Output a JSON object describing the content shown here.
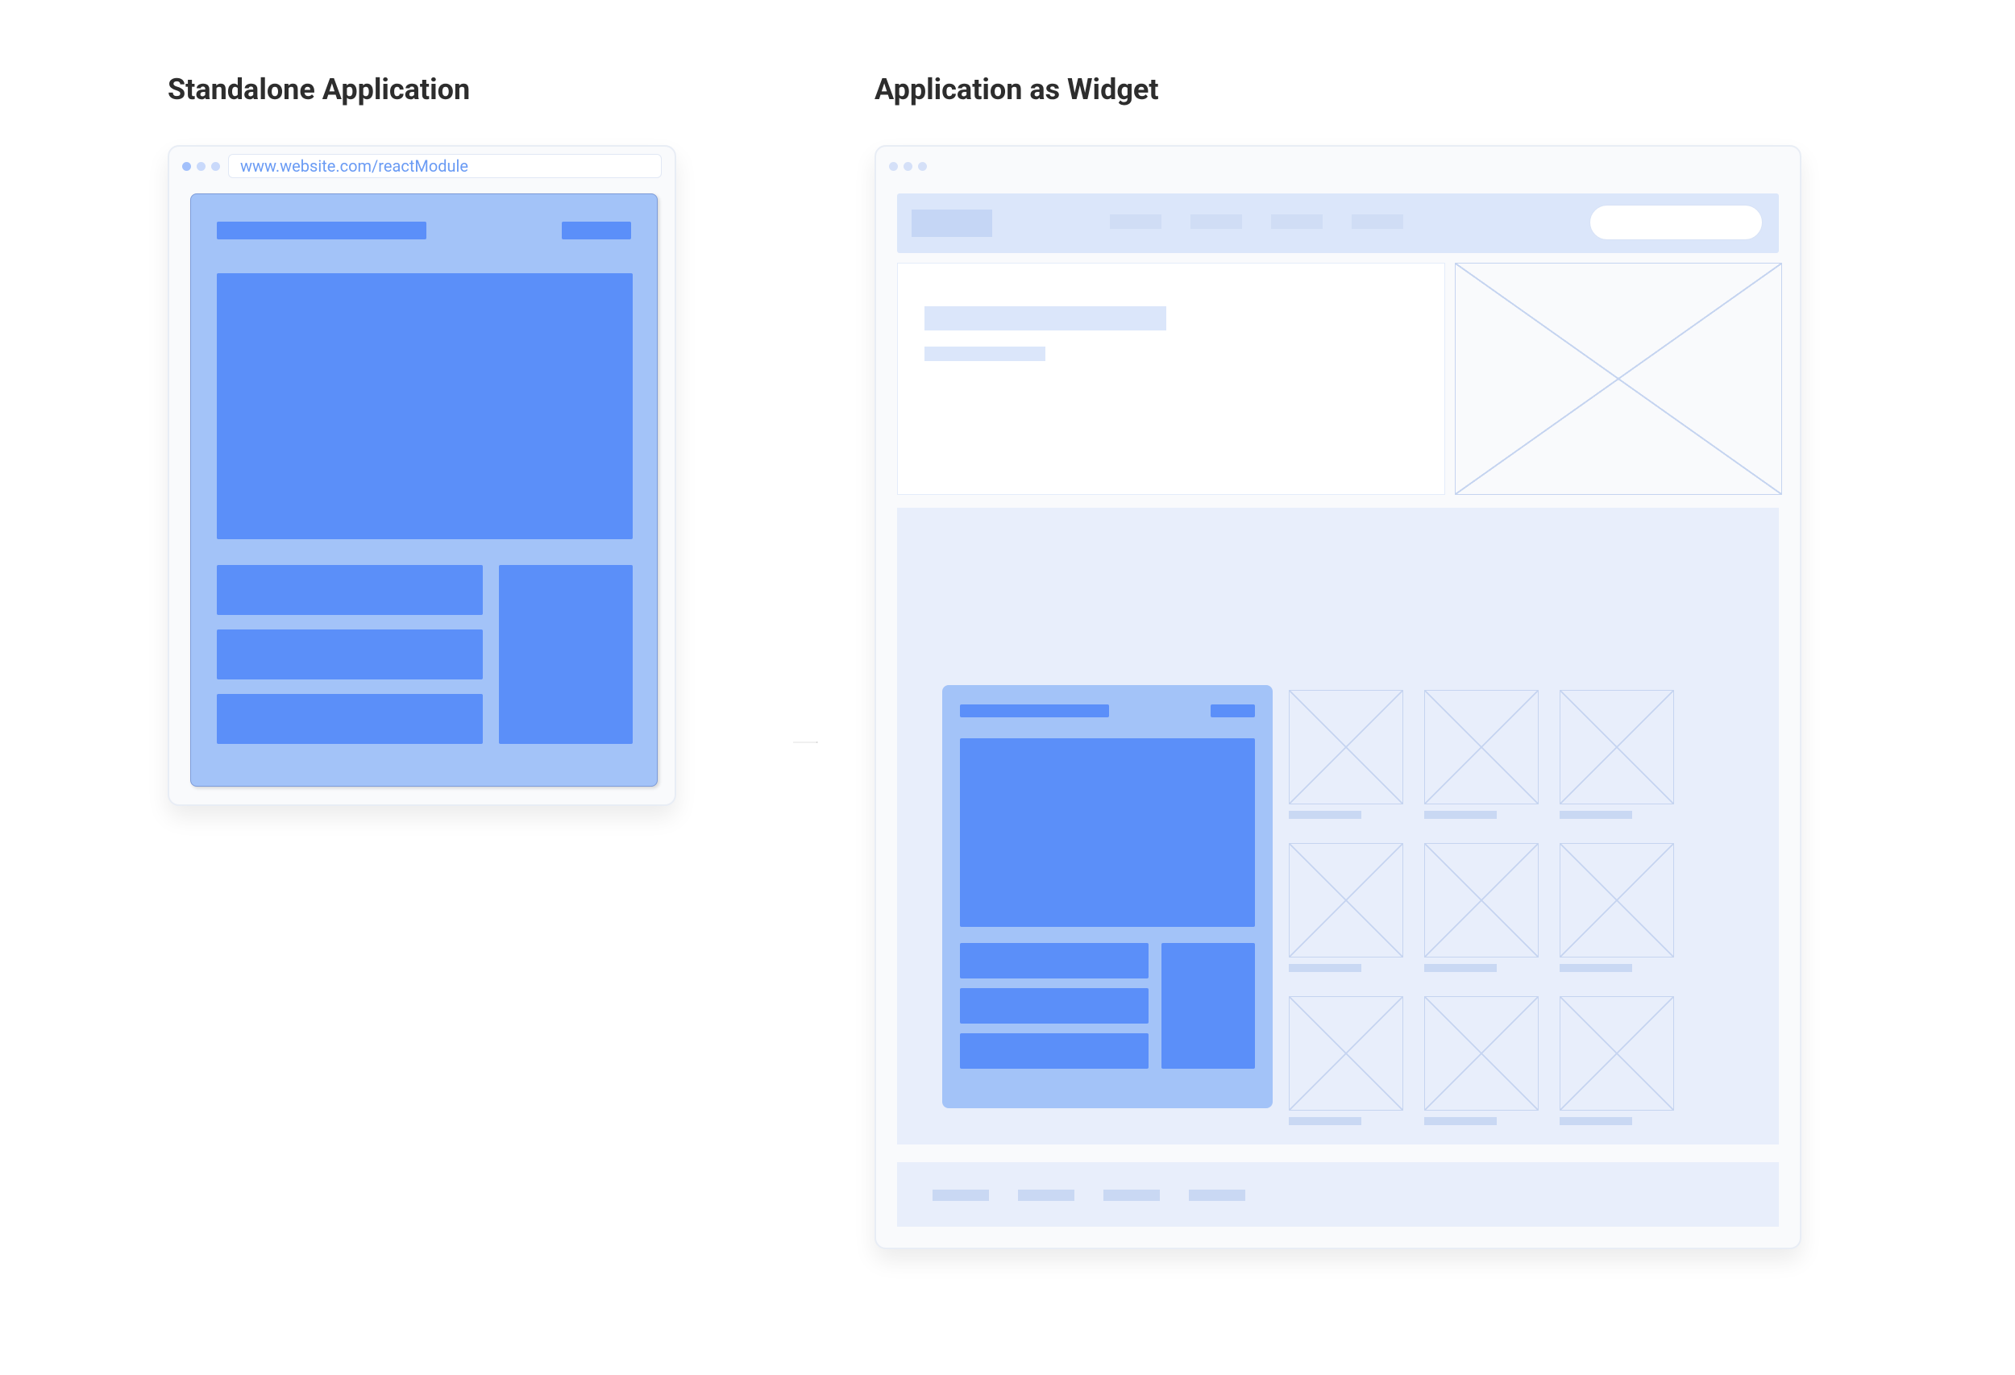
{
  "titles": {
    "standalone": "Standalone Application",
    "widget": "Application as Widget"
  },
  "standalone_browser": {
    "url": "www.website.com/reactModule"
  },
  "colors": {
    "app_panel_bg": "#a3c3f8",
    "app_block": "#5b8ff9",
    "wireframe_pale": "#dbe6fa",
    "wireframe_border": "#c5d4f0",
    "text_dark": "#2d2d2d"
  },
  "diagram": {
    "concept": "A React module rendered as a full standalone page on the left is embedded as a widget inside a larger host website wireframe on the right.",
    "arrow_direction": "left-to-right"
  }
}
